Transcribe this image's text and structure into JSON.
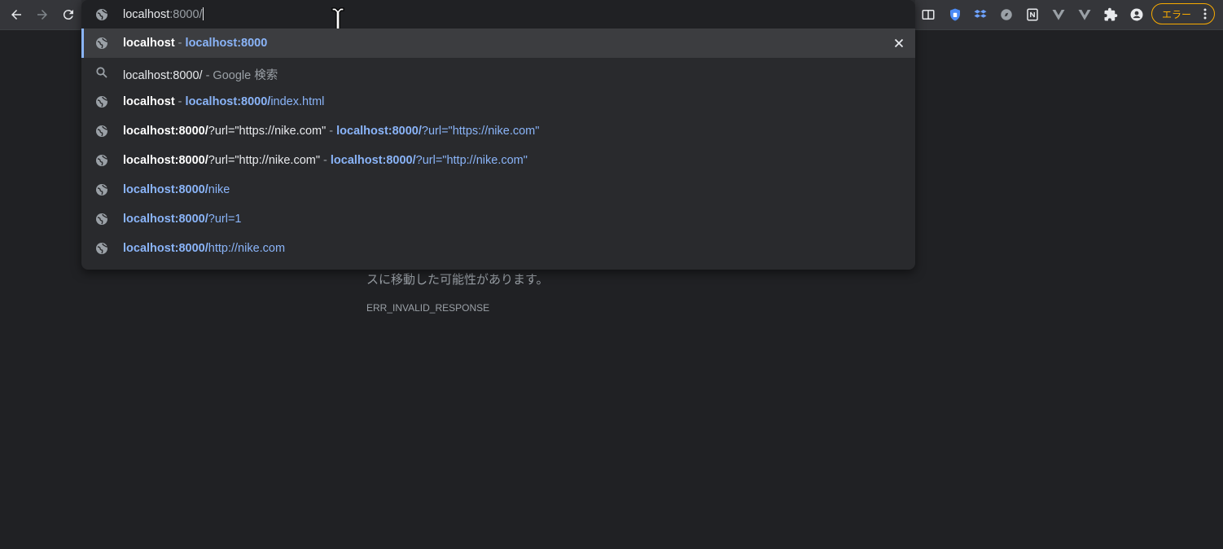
{
  "omnibox": {
    "typed_bold": "localhost",
    "typed_dim": ":8000/"
  },
  "suggestions": [
    {
      "parts": [
        {
          "t": "localhost",
          "c": "b"
        },
        {
          "t": " - ",
          "c": "sep"
        },
        {
          "t": "localhost:8000",
          "c": "ub"
        }
      ]
    },
    {
      "parts": [
        {
          "t": "localhost:8000/",
          "c": "w"
        },
        {
          "t": " - Google 検索",
          "c": "g"
        }
      ]
    },
    {
      "parts": [
        {
          "t": "localhost",
          "c": "b"
        },
        {
          "t": " - ",
          "c": "sep"
        },
        {
          "t": "localhost:8000/",
          "c": "ub"
        },
        {
          "t": "index.html",
          "c": "u"
        }
      ]
    },
    {
      "parts": [
        {
          "t": "localhost:8000/",
          "c": "b"
        },
        {
          "t": "?url=\"https://nike.com\"",
          "c": "w"
        },
        {
          "t": " - ",
          "c": "sep"
        },
        {
          "t": "localhost:8000/",
          "c": "ub"
        },
        {
          "t": "?url=\"https://nike.com\"",
          "c": "u"
        }
      ]
    },
    {
      "parts": [
        {
          "t": "localhost:8000/",
          "c": "b"
        },
        {
          "t": "?url=\"http://nike.com\"",
          "c": "w"
        },
        {
          "t": " - ",
          "c": "sep"
        },
        {
          "t": "localhost:8000/",
          "c": "ub"
        },
        {
          "t": "?url=\"http://nike.com\"",
          "c": "u"
        }
      ]
    },
    {
      "parts": [
        {
          "t": "localhost:8000/",
          "c": "ub"
        },
        {
          "t": "nike",
          "c": "u"
        }
      ]
    },
    {
      "parts": [
        {
          "t": "localhost:8000/",
          "c": "ub"
        },
        {
          "t": "?url=1",
          "c": "u"
        }
      ]
    },
    {
      "parts": [
        {
          "t": "localhost:8000/",
          "c": "ub"
        },
        {
          "t": "http://nike.com",
          "c": "u"
        }
      ]
    }
  ],
  "profile_badge": "エラー",
  "error_page": {
    "message_tail": "スに移動した可能性があります。",
    "code": "ERR_INVALID_RESPONSE"
  }
}
